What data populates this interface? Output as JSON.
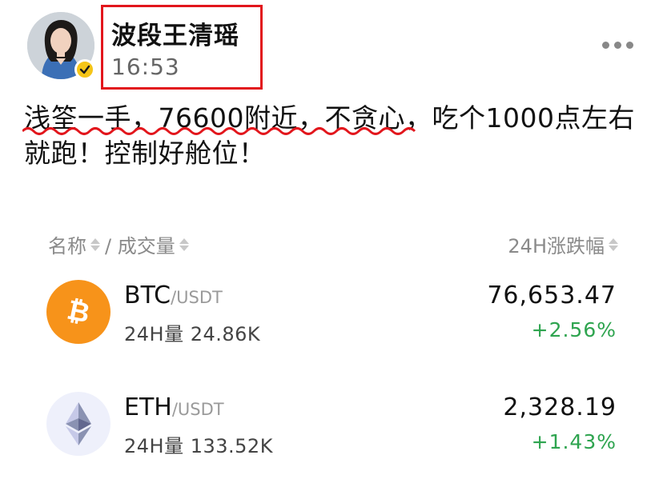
{
  "post": {
    "author": "波段王清瑶",
    "time": "16:53",
    "text_line1": "浅筌一手，76600附近，不贪心，吃个1000点左右",
    "text_line2": "就跑！控制好舱位！"
  },
  "list_header": {
    "name_label": "名称",
    "volume_label": "/ 成交量",
    "change_label": "24H涨跌幅"
  },
  "coins": [
    {
      "symbol": "BTC",
      "quote": "/USDT",
      "volume": "24H量 24.86K",
      "price": "76,653.47",
      "change": "+2.56%",
      "color": "#f7931a"
    },
    {
      "symbol": "ETH",
      "quote": "/USDT",
      "volume": "24H量 133.52K",
      "price": "2,328.19",
      "change": "+1.43%",
      "color": "#627eea"
    }
  ],
  "colors": {
    "highlight_box": "#e2161c",
    "squiggle": "#e2161c",
    "positive_change": "#2ea44f",
    "verified_badge": "#f5c518"
  },
  "icons": [
    "avatar",
    "verified-icon",
    "more-icon",
    "sort-icon",
    "btc-icon",
    "eth-icon"
  ]
}
